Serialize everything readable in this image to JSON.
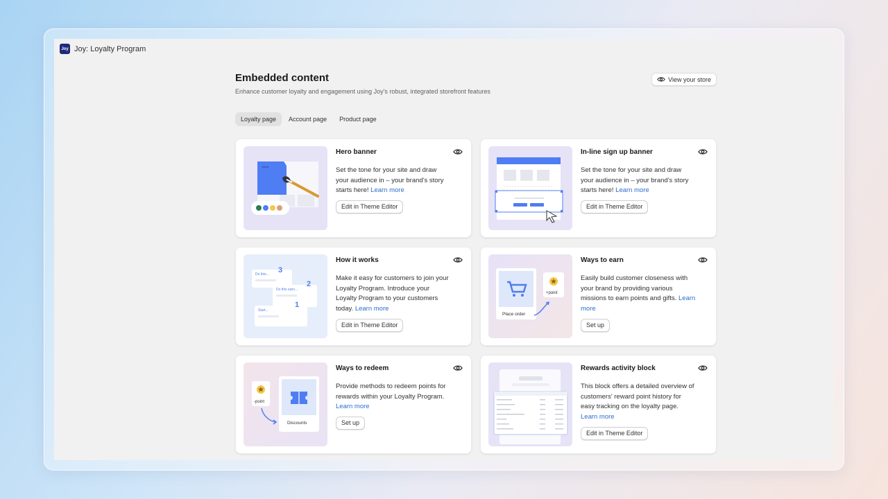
{
  "app": {
    "title": "Joy: Loyalty Program",
    "logo_text": "Joy"
  },
  "page": {
    "title": "Embedded content",
    "subtitle": "Enhance customer loyalty and engagement using Joy's robust, integrated storefront features",
    "view_store_label": "View your store"
  },
  "tabs": [
    {
      "label": "Loyalty page",
      "active": true
    },
    {
      "label": "Account page",
      "active": false
    },
    {
      "label": "Product page",
      "active": false
    }
  ],
  "cards": [
    {
      "title": "Hero banner",
      "desc": "Set the tone for your site and draw your audience in – your brand's story starts here!",
      "link": "Learn more",
      "button": "Edit in Theme Editor"
    },
    {
      "title": "In-line sign up banner",
      "desc": "Set the tone for your site and draw your audience in – your brand's story starts here!",
      "link": "Learn more",
      "button": "Edit in Theme Editor"
    },
    {
      "title": "How it works",
      "desc": "Make it easy for customers to join your Loyalty Program. Introduce your Loyalty Program to your customers today.",
      "link": "Learn more",
      "button": "Edit in Theme Editor",
      "thumb": {
        "steps": [
          "3",
          "2",
          "1"
        ],
        "labels": [
          "Do this...",
          "Do this earn...",
          "Start..."
        ]
      }
    },
    {
      "title": "Ways to earn",
      "desc": "Easily build customer closeness with your brand by providing various missions to earn points and gifts.",
      "link": "Learn more",
      "button": "Set up",
      "thumb": {
        "tile_label": "Place order",
        "point_label": "+point"
      }
    },
    {
      "title": "Ways to redeem",
      "desc": "Provide methods to redeem points for rewards within your Loyalty Program.",
      "link": "Learn more",
      "button": "Set up",
      "thumb": {
        "tile_label": "Discounts",
        "point_label": "-point"
      }
    },
    {
      "title": "Rewards activity block",
      "desc": "This block offers a detailed overview of customers' reward point history for easy tracking on the loyalty page.",
      "link": "Learn more",
      "button": "Edit in Theme Editor"
    }
  ],
  "colors": {
    "accent": "#4f7df3",
    "link": "#2c6ecb",
    "brand": "#1f2a7a",
    "gold": "#f4c74a"
  }
}
